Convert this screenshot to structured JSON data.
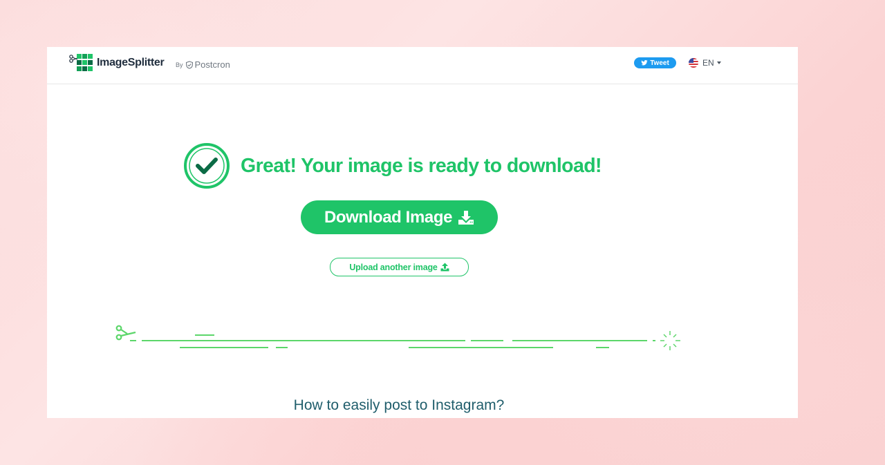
{
  "header": {
    "brand_name": "ImageSplitter",
    "by_label": "By",
    "partner_name": "Postcron",
    "tweet_label": "Tweet",
    "language": "EN"
  },
  "main": {
    "headline": "Great! Your image is ready to download!",
    "download_label": "Download Image",
    "upload_label": "Upload another image",
    "section_title": "How to easily post to Instagram?"
  },
  "colors": {
    "brand_green": "#1fc468",
    "dark_green": "#0b6b45",
    "twitter_blue": "#1d9bf0",
    "heading_teal": "#1f5d6b",
    "background_pink": "#fcd9d9"
  },
  "icons": {
    "logo": "grid-scissors-logo",
    "partner": "shield-check-icon",
    "tweet": "twitter-bird-icon",
    "language": "us-flag-icon",
    "language_toggle": "caret-down-icon",
    "success": "check-circle-icon",
    "download": "download-icon",
    "upload": "upload-icon",
    "divider": "scissors-icon"
  }
}
